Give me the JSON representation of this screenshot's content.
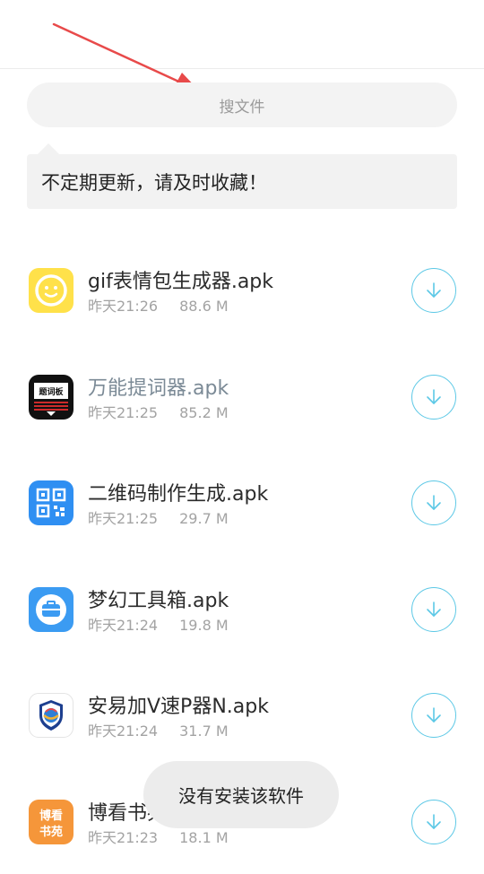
{
  "search": {
    "placeholder": "搜文件"
  },
  "notice": {
    "text": "不定期更新，请及时收藏！"
  },
  "files": [
    {
      "name": "gif表情包生成器.apk",
      "time": "昨天21:26",
      "size": "88.6 M",
      "icon": "smiley-face-icon"
    },
    {
      "name": "万能提词器.apk",
      "time": "昨天21:25",
      "size": "85.2 M",
      "icon": "teleprompter-icon",
      "icon_text": "题词板"
    },
    {
      "name": "二维码制作生成.apk",
      "time": "昨天21:25",
      "size": "29.7 M",
      "icon": "qr-code-icon"
    },
    {
      "name": "梦幻工具箱.apk",
      "time": "昨天21:24",
      "size": "19.8 M",
      "icon": "toolbox-icon"
    },
    {
      "name": "安易加V速P器N.apk",
      "time": "昨天21:24",
      "size": "31.7 M",
      "icon": "shield-globe-icon"
    },
    {
      "name": "博看书苑.apk",
      "time": "昨天21:23",
      "size": "18.1 M",
      "icon": "bookan-icon",
      "icon_text": "博看书苑"
    }
  ],
  "toast": {
    "text": "没有安装该软件"
  },
  "colors": {
    "accent": "#5cc8e6",
    "annotation_arrow": "#e84a4a"
  }
}
